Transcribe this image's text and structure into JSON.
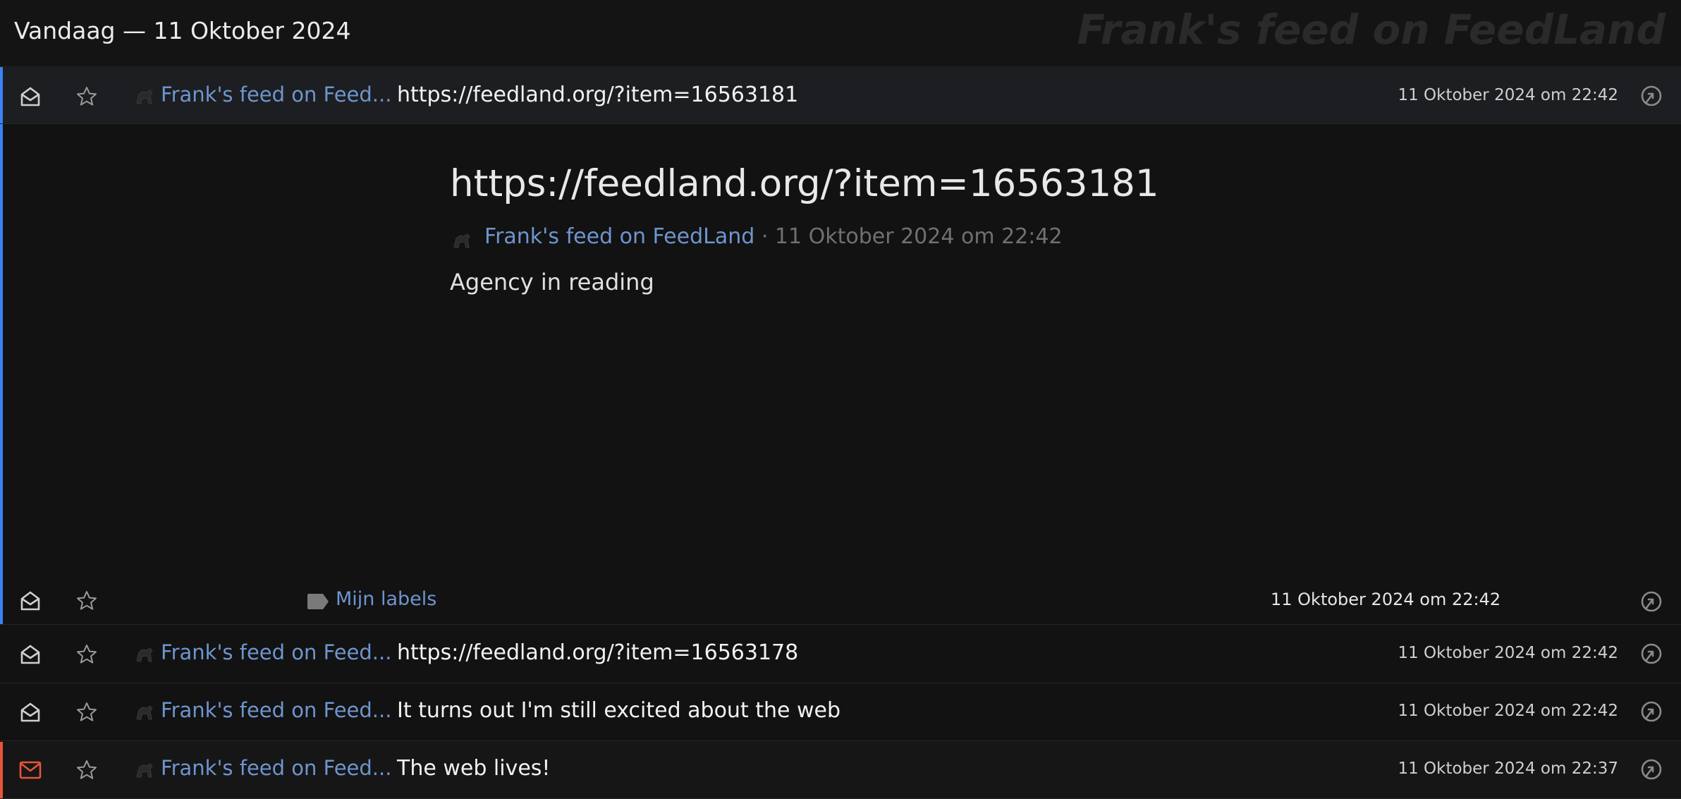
{
  "header": {
    "day_title": "Vandaag — 11 Oktober 2024",
    "feed_title": "Frank's feed on FeedLand"
  },
  "items": [
    {
      "feed": "Frank's feed on Feed...",
      "title": "https://feedland.org/?item=16563181",
      "date": "11 Oktober 2024 om 22:42",
      "state": "read",
      "selected": true
    },
    {
      "feed": "Frank's feed on Feed...",
      "title": "https://feedland.org/?item=16563178",
      "date": "11 Oktober 2024 om 22:42",
      "state": "read",
      "selected": false
    },
    {
      "feed": "Frank's feed on Feed...",
      "title": "It turns out I'm still excited about the web",
      "date": "11 Oktober 2024 om 22:42",
      "state": "read",
      "selected": false
    },
    {
      "feed": "Frank's feed on Feed...",
      "title": "The web lives!",
      "date": "11 Oktober 2024 om 22:37",
      "state": "unread",
      "selected": false
    }
  ],
  "article": {
    "title": "https://feedland.org/?item=16563181",
    "feed": "Frank's feed on FeedLand",
    "separator": " · ",
    "date": "11 Oktober 2024 om 22:42",
    "body": "Agency in reading",
    "labels_link": "Mijn labels",
    "footer_date": "11 Oktober 2024 om 22:42"
  },
  "colors": {
    "accent_selected": "#3b82f6",
    "accent_unread": "#e8553a",
    "link": "#6e95cf"
  },
  "icons": {
    "read": "envelope-open-icon",
    "unread": "envelope-closed-icon",
    "star": "star-icon",
    "feed": "feed-favicon-icon",
    "share": "share-icon",
    "label": "label-tag-icon"
  }
}
